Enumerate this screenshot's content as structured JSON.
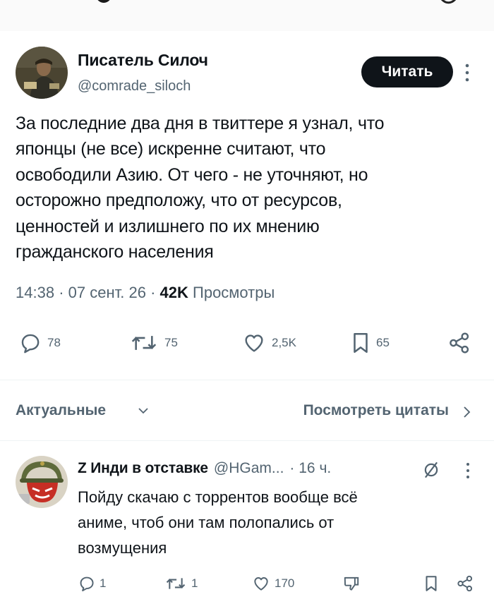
{
  "tweet": {
    "author_name": "Писатель Силоч",
    "author_handle": "@comrade_siloch",
    "follow_label": "Читать",
    "text": "За последние два дня в твиттере я узнал, что\nяпонцы (не все) искренне считают, что\nосвободили Азию. От чего - не уточняют, но\nосторожно предположу, что от ресурсов,\nценностей и излишнего по их мнению\nгражданского населения",
    "time": "14:38",
    "date": "07 сент. 26",
    "views_count": "42K",
    "views_label": "Просмотры",
    "stats": {
      "replies": "78",
      "reposts": "75",
      "likes": "2,5K",
      "bookmarks": "65"
    }
  },
  "replies_bar": {
    "sort_label": "Актуальные",
    "quotes_label": "Посмотреть цитаты"
  },
  "reply": {
    "name": "Z Инди в отставке",
    "handle": "@HGam...",
    "time": "· 16 ч.",
    "text": "Пойду скачаю с торрентов вообще всё\nаниме, чтоб они там полопались от\nвозмущения",
    "stats": {
      "replies": "1",
      "reposts": "1",
      "likes": "170"
    }
  },
  "icons": {
    "reply": "speech-bubble-icon",
    "repost": "repost-arrows-icon",
    "like": "heart-icon",
    "bookmark": "bookmark-icon",
    "share": "share-nodes-icon",
    "more": "vertical-dots-icon",
    "grok": "grok-slash-icon",
    "downvote": "thumb-down-icon"
  },
  "colors": {
    "text": "#0f1419",
    "secondary": "#536471",
    "button": "#0f1419"
  }
}
